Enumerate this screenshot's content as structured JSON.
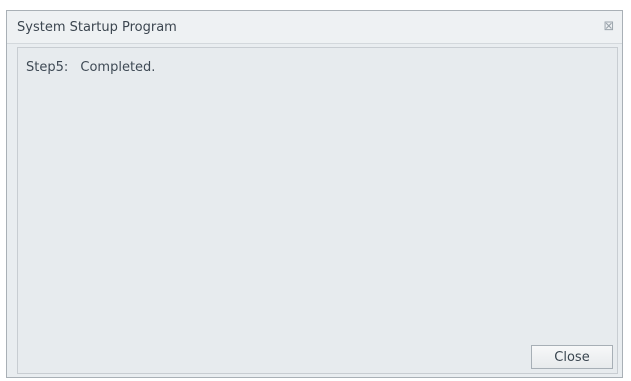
{
  "window": {
    "title": "System Startup Program",
    "close_glyph": "⊠"
  },
  "status": {
    "step": "Step5:",
    "message": "Completed."
  },
  "actions": {
    "close_label": "Close"
  },
  "icons": {
    "window_close": "close-icon"
  },
  "colors": {
    "window_background": "#e9edf0",
    "titlebar_background": "#eef1f3",
    "content_background": "#e7ebee",
    "border": "#a9b0b6",
    "text": "#3c4650"
  }
}
